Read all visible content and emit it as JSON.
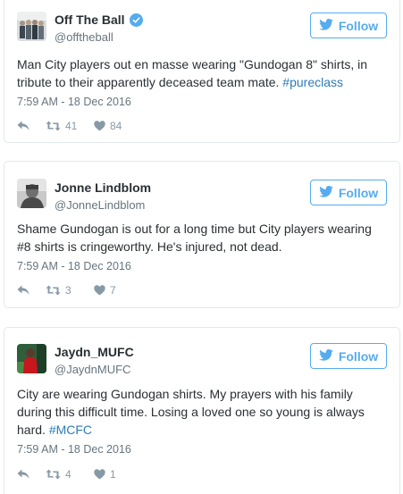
{
  "colors": {
    "twitter_blue": "#55acee",
    "hashtag": "#2b7bb9",
    "muted": "#66757f",
    "action_gray": "#8899a6",
    "border": "#e1e8ed"
  },
  "follow_label": "Follow",
  "tweets": [
    {
      "display_name": "Off The Ball",
      "verified": true,
      "handle": "@offtheball",
      "text": "Man City players out en masse wearing \"Gundogan 8\" shirts, in tribute to their apparently deceased team mate.",
      "hashtag": "#pureclass",
      "timestamp": "7:59 AM - 18 Dec 2016",
      "retweets": "41",
      "likes": "84"
    },
    {
      "display_name": "Jonne Lindblom",
      "verified": false,
      "handle": "@JonneLindblom",
      "text": "Shame Gundogan is out for a long time but City players wearing #8 shirts is cringeworthy. He's injured, not dead.",
      "hashtag": "",
      "timestamp": "7:59 AM - 18 Dec 2016",
      "retweets": "3",
      "likes": "7"
    },
    {
      "display_name": "Jaydn_MUFC",
      "verified": false,
      "handle": "@JaydnMUFC",
      "text": "City are wearing Gundogan shirts. My prayers with his family during this difficult time. Losing a loved one so young is always hard.",
      "hashtag": "#MCFC",
      "timestamp": "7:59 AM - 18 Dec 2016",
      "retweets": "4",
      "likes": "1"
    }
  ]
}
